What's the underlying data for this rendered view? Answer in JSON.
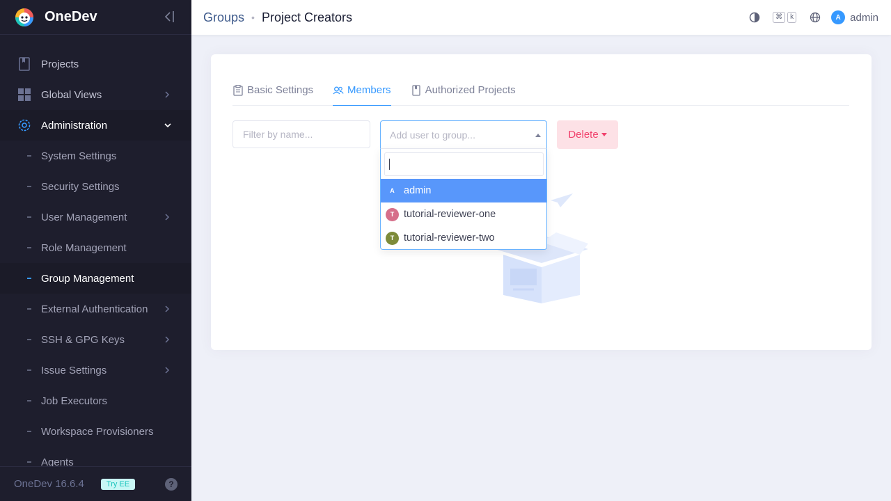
{
  "app": {
    "name": "OneDev",
    "version": "OneDev 16.6.4",
    "try_ee": "Try EE"
  },
  "sidebar": {
    "items": [
      {
        "label": "Projects",
        "icon": "bookmark-icon"
      },
      {
        "label": "Global Views",
        "icon": "grid-icon"
      },
      {
        "label": "Administration",
        "icon": "gear-icon"
      }
    ],
    "admin_sub": [
      {
        "label": "System Settings"
      },
      {
        "label": "Security Settings"
      },
      {
        "label": "User Management"
      },
      {
        "label": "Role Management"
      },
      {
        "label": "Group Management"
      },
      {
        "label": "External Authentication"
      },
      {
        "label": "SSH & GPG Keys"
      },
      {
        "label": "Issue Settings"
      },
      {
        "label": "Job Executors"
      },
      {
        "label": "Workspace Provisioners"
      },
      {
        "label": "Agents"
      }
    ]
  },
  "topbar": {
    "breadcrumb_link": "Groups",
    "breadcrumb_sep": "•",
    "breadcrumb_current": "Project Creators",
    "kbd_cmd": "⌘",
    "kbd_k": "k",
    "user": "admin",
    "user_initial": "A"
  },
  "tabs": [
    {
      "label": "Basic Settings"
    },
    {
      "label": "Members"
    },
    {
      "label": "Authorized Projects"
    }
  ],
  "members": {
    "filter_placeholder": "Filter by name...",
    "add_placeholder": "Add user to group...",
    "delete_label": "Delete",
    "dropdown_search_value": "",
    "options": [
      {
        "name": "admin",
        "initial": "A",
        "color": "#5897fb"
      },
      {
        "name": "tutorial-reviewer-one",
        "initial": "T",
        "color": "#d66f8a"
      },
      {
        "name": "tutorial-reviewer-two",
        "initial": "T",
        "color": "#7d8b3a"
      }
    ]
  },
  "colors": {
    "accent": "#3699ff",
    "sidebar_bg": "#1e1e2d",
    "danger": "#f1416c"
  }
}
